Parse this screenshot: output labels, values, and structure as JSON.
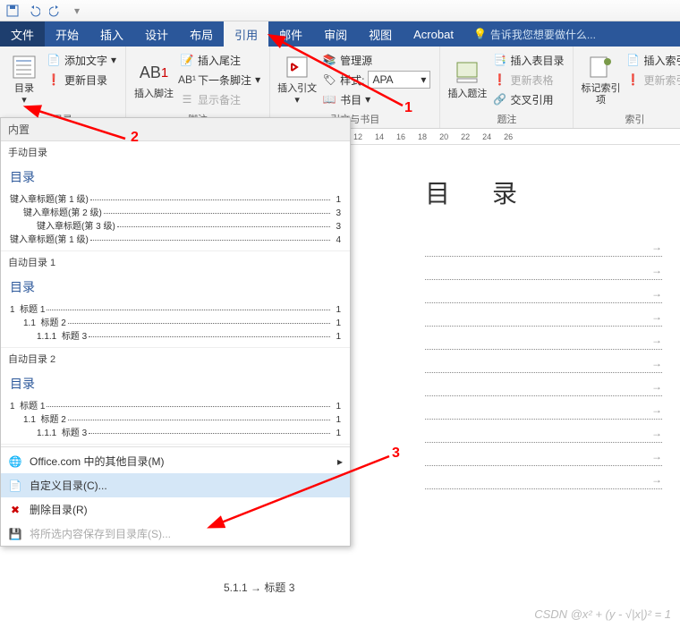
{
  "qat": {
    "save": "保存",
    "undo": "撤销",
    "redo": "重做"
  },
  "tabs": {
    "file": "文件",
    "home": "开始",
    "insert": "插入",
    "design": "设计",
    "layout": "布局",
    "references": "引用",
    "mailings": "邮件",
    "review": "审阅",
    "view": "视图",
    "acrobat": "Acrobat",
    "tell": "告诉我您想要做什么..."
  },
  "ribbon": {
    "toc": {
      "btn": "目录",
      "add_text": "添加文字",
      "update": "更新目录",
      "grp": "目录"
    },
    "fn": {
      "big": "插入脚注",
      "big2": "AB",
      "endnote": "插入尾注",
      "next": "下一条脚注",
      "show": "显示备注",
      "grp": "脚注"
    },
    "cit": {
      "big": "插入引文",
      "manage": "管理源",
      "style_lbl": "样式:",
      "style": "APA",
      "bib": "书目",
      "grp": "引文与书目"
    },
    "cap": {
      "big": "插入题注",
      "grp": "题注"
    },
    "idx": {
      "toc": "插入表目录",
      "upd": "更新表格",
      "cross": "交叉引用"
    },
    "mark": {
      "big": "标记索引项",
      "grp": "索引",
      "ins": "插入索引",
      "upd": "更新索引"
    }
  },
  "ruler": [
    "12",
    "14",
    "16",
    "18",
    "20",
    "22",
    "24",
    "26"
  ],
  "menu": {
    "builtin": "内置",
    "manual": "手动目录",
    "toc_h": "目录",
    "m_l1": "键入章标题(第 1 级)",
    "m_l2": "键入章标题(第 2 级)",
    "m_l3": "键入章标题(第 3 级)",
    "m_l1b": "键入章标题(第 1 级)",
    "auto1": "自动目录 1",
    "auto2": "自动目录 2",
    "a_h1": "标题 1",
    "a_h2": "标题 2",
    "a_h3": "标题 3",
    "pg1": "1",
    "pg3": "3",
    "pg4": "4",
    "n1": "1",
    "n11": "1.1",
    "n111": "1.1.1",
    "office": "Office.com 中的其他目录(M)",
    "custom": "自定义目录(C)...",
    "remove": "删除目录(R)",
    "save": "将所选内容保存到目录库(S)..."
  },
  "doc": {
    "title": "目  录",
    "line_body": "5.1.1 → 标题 3"
  },
  "annot": {
    "a1": "1",
    "a2": "2",
    "a3": "3"
  },
  "watermark": "CSDN @x² + (y - √|x|)² = 1"
}
